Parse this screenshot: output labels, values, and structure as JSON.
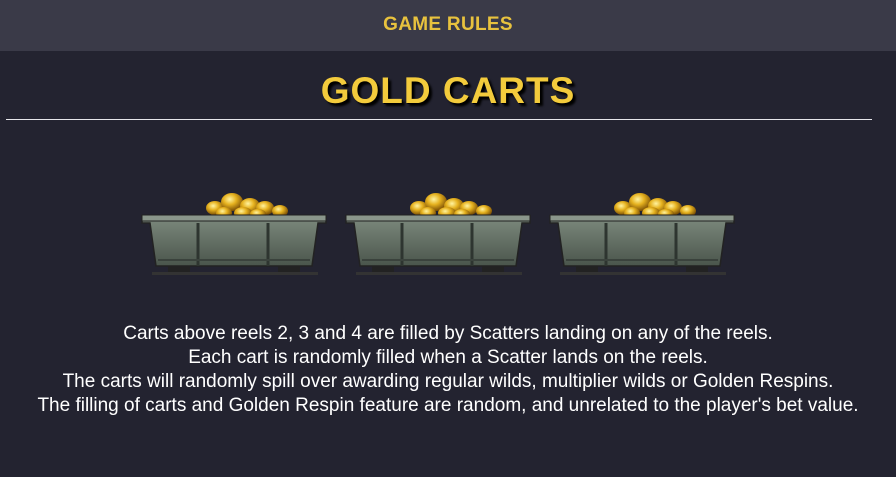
{
  "header": {
    "title": "GAME RULES"
  },
  "section": {
    "title": "GOLD CARTS"
  },
  "carts": [
    {
      "name": "gold-cart-icon"
    },
    {
      "name": "gold-cart-icon"
    },
    {
      "name": "gold-cart-icon"
    }
  ],
  "description": {
    "lines": [
      "Carts above reels 2, 3 and 4 are filled by Scatters landing on any of the reels.",
      "Each cart is randomly filled when a Scatter lands on the reels.",
      "The carts will randomly spill over awarding regular wilds, multiplier wilds or Golden Respins.",
      "The filling of carts and Golden Respin feature are random, and unrelated to the player's bet value."
    ]
  },
  "colors": {
    "background": "#232330",
    "header_bar": "#3a3a48",
    "accent_gold": "#f3cb3c",
    "text": "#ffffff"
  }
}
